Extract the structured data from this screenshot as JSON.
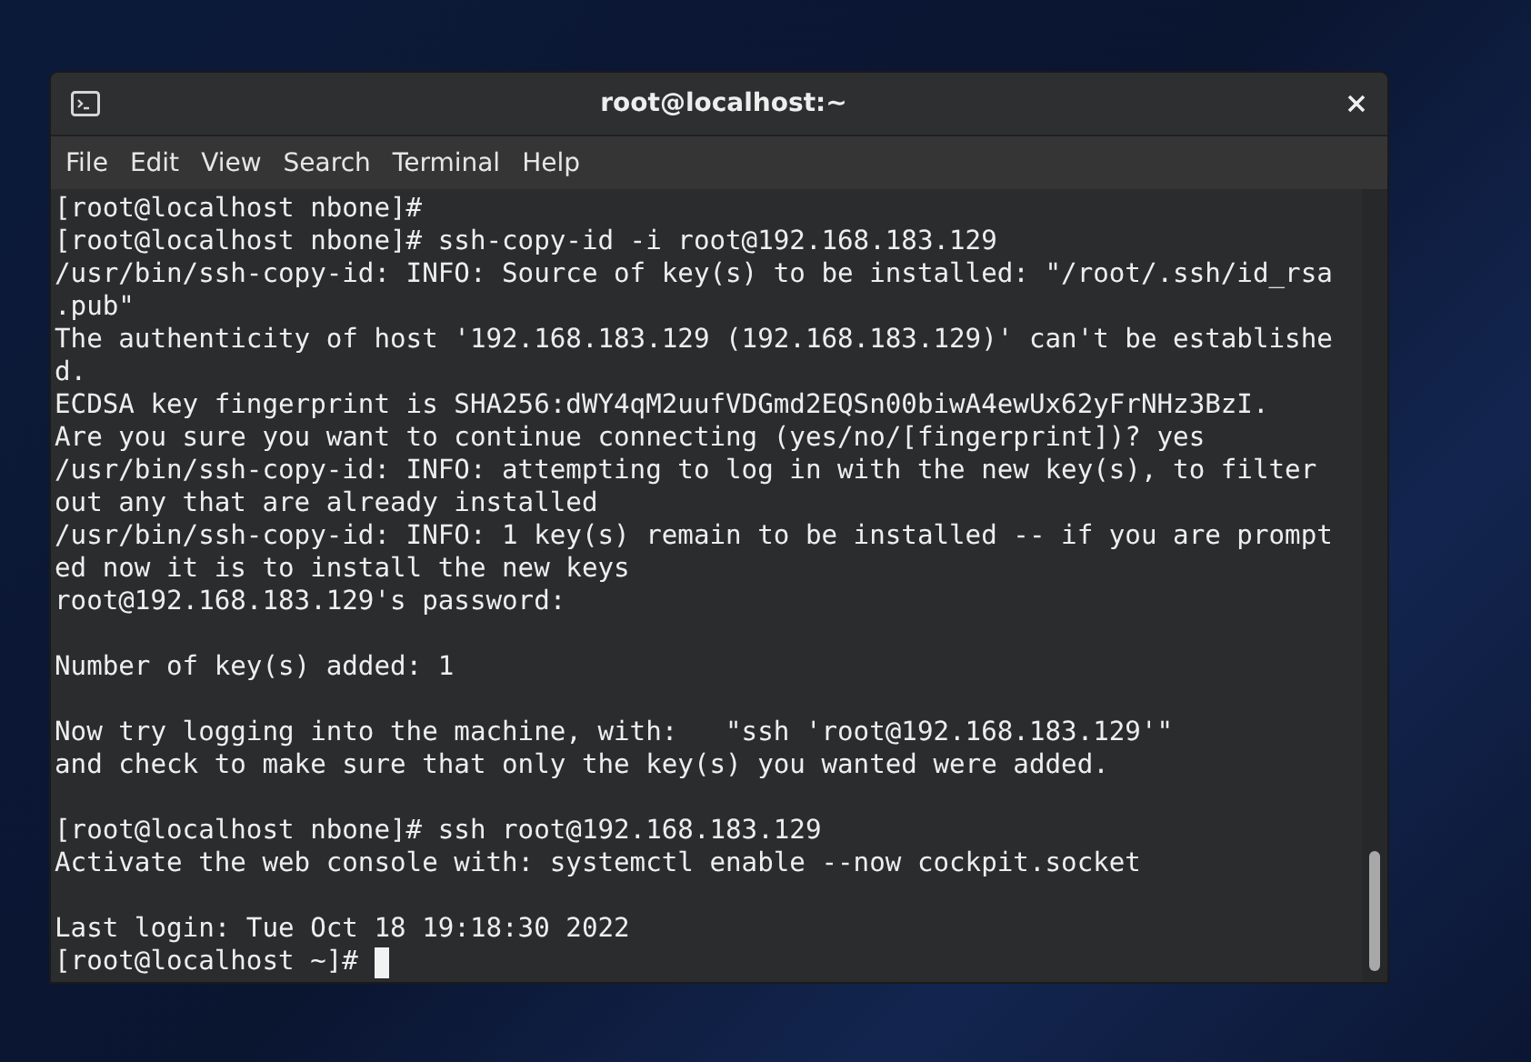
{
  "window": {
    "title": "root@localhost:~"
  },
  "menu": [
    "File",
    "Edit",
    "View",
    "Search",
    "Terminal",
    "Help"
  ],
  "terminal": {
    "lines": [
      {
        "kind": "text",
        "text": "[root@localhost nbone]#"
      },
      {
        "kind": "text",
        "text": "[root@localhost nbone]# ssh-copy-id -i root@192.168.183.129"
      },
      {
        "kind": "text",
        "text": "/usr/bin/ssh-copy-id: INFO: Source of key(s) to be installed: \"/root/.ssh/id_rsa"
      },
      {
        "kind": "text",
        "text": ".pub\""
      },
      {
        "kind": "text",
        "text": "The authenticity of host '192.168.183.129 (192.168.183.129)' can't be establishe"
      },
      {
        "kind": "text",
        "text": "d."
      },
      {
        "kind": "text",
        "text": "ECDSA key fingerprint is SHA256:dWY4qM2uufVDGmd2EQSn00biwA4ewUx62yFrNHz3BzI."
      },
      {
        "kind": "text",
        "text": "Are you sure you want to continue connecting (yes/no/[fingerprint])? yes"
      },
      {
        "kind": "text",
        "text": "/usr/bin/ssh-copy-id: INFO: attempting to log in with the new key(s), to filter"
      },
      {
        "kind": "text",
        "text": "out any that are already installed"
      },
      {
        "kind": "text",
        "text": "/usr/bin/ssh-copy-id: INFO: 1 key(s) remain to be installed -- if you are prompt"
      },
      {
        "kind": "text",
        "text": "ed now it is to install the new keys"
      },
      {
        "kind": "text",
        "text": "root@192.168.183.129's password:"
      },
      {
        "kind": "blank"
      },
      {
        "kind": "text",
        "text": "Number of key(s) added: 1"
      },
      {
        "kind": "blank"
      },
      {
        "kind": "text",
        "text": "Now try logging into the machine, with:   \"ssh 'root@192.168.183.129'\""
      },
      {
        "kind": "text",
        "text": "and check to make sure that only the key(s) you wanted were added."
      },
      {
        "kind": "blank"
      },
      {
        "kind": "text",
        "text": "[root@localhost nbone]# ssh root@192.168.183.129"
      },
      {
        "kind": "text",
        "text": "Activate the web console with: systemctl enable --now cockpit.socket"
      },
      {
        "kind": "blank"
      },
      {
        "kind": "text",
        "text": "Last login: Tue Oct 18 19:18:30 2022"
      },
      {
        "kind": "prompt",
        "text": "[root@localhost ~]#"
      }
    ]
  }
}
